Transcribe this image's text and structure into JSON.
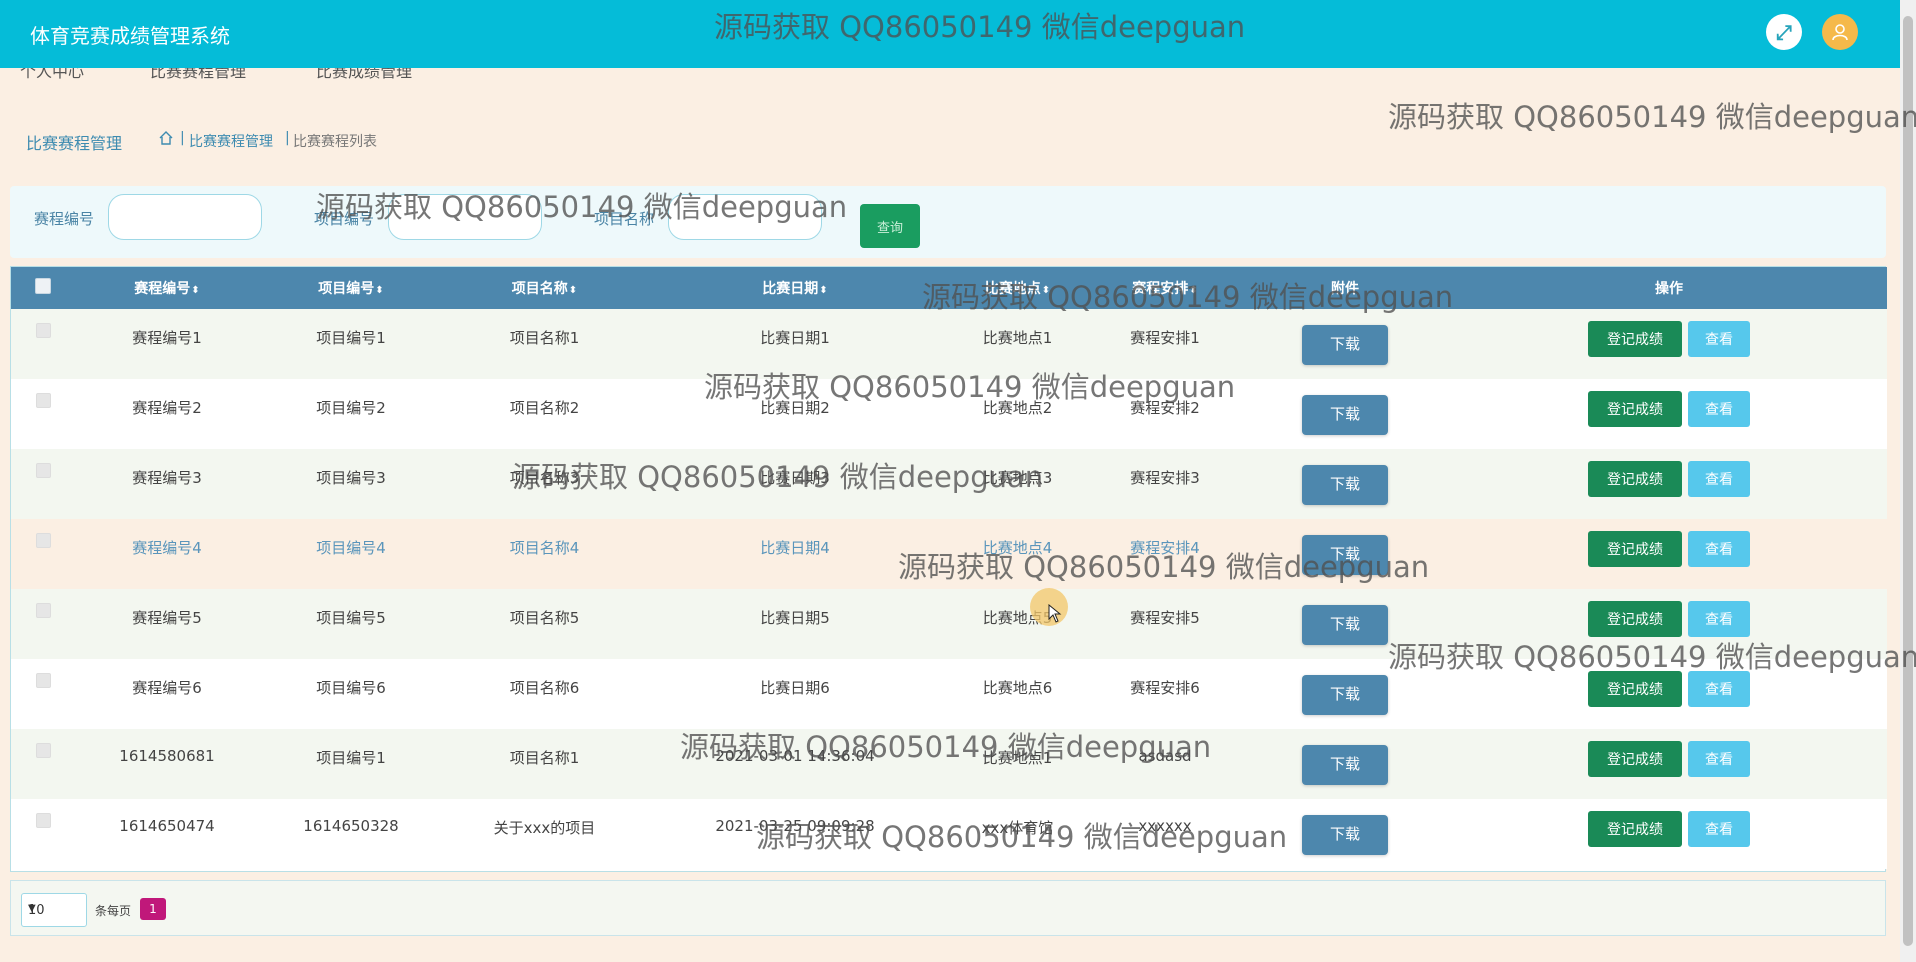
{
  "header": {
    "title": "体育竞赛成绩管理系统"
  },
  "nav": {
    "items": [
      "个人中心",
      "比赛赛程管理",
      "比赛成绩管理"
    ]
  },
  "breadcrumb": {
    "title": "比赛赛程管理",
    "items": [
      "比赛赛程管理",
      "比赛赛程列表"
    ]
  },
  "search": {
    "labels": [
      "赛程编号",
      "项目编号",
      "项目名称"
    ],
    "button": "查询"
  },
  "table": {
    "headers": [
      "赛程编号",
      "项目编号",
      "项目名称",
      "比赛日期",
      "比赛地点",
      "赛程安排",
      "附件",
      "操作"
    ],
    "download_label": "下载",
    "register_label": "登记成绩",
    "view_label": "查看",
    "rows": [
      [
        "赛程编号1",
        "项目编号1",
        "项目名称1",
        "比赛日期1",
        "比赛地点1",
        "赛程安排1"
      ],
      [
        "赛程编号2",
        "项目编号2",
        "项目名称2",
        "比赛日期2",
        "比赛地点2",
        "赛程安排2"
      ],
      [
        "赛程编号3",
        "项目编号3",
        "项目名称3",
        "比赛日期3",
        "比赛地点3",
        "赛程安排3"
      ],
      [
        "赛程编号4",
        "项目编号4",
        "项目名称4",
        "比赛日期4",
        "比赛地点4",
        "赛程安排4"
      ],
      [
        "赛程编号5",
        "项目编号5",
        "项目名称5",
        "比赛日期5",
        "比赛地点5",
        "赛程安排5"
      ],
      [
        "赛程编号6",
        "项目编号6",
        "项目名称6",
        "比赛日期6",
        "比赛地点6",
        "赛程安排6"
      ],
      [
        "1614580681",
        "项目编号1",
        "项目名称1",
        "2021-03-01 14:36:04",
        "比赛地点1",
        "asdasd"
      ],
      [
        "1614650474",
        "1614650328",
        "关于xxx的项目",
        "2021-03-25 09:09:28",
        "xxx体育馆",
        "xxxxxx"
      ]
    ]
  },
  "pagination": {
    "page_size": "10",
    "per_page_label": "条每页",
    "current_page": "1"
  },
  "watermark": {
    "text": "源码获取 QQ86050149 微信deepguan"
  },
  "colors": {
    "header": "#05bcd8",
    "table_header": "#4d87ad",
    "register": "#1a8a57",
    "view": "#56c8ec",
    "page_active": "#c0187a"
  }
}
